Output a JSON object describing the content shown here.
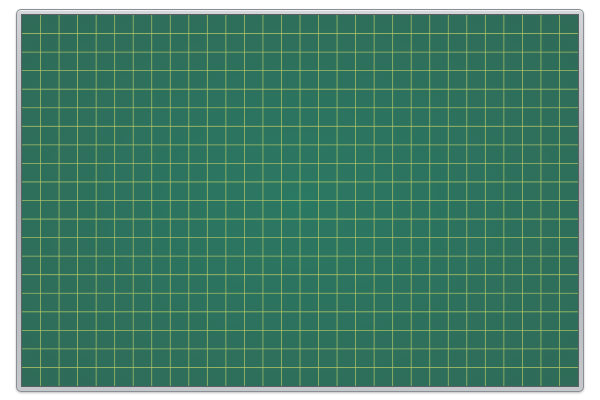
{
  "board": {
    "surface_color": "#2f6b58",
    "surface_color_center": "#2b7863",
    "frame_color": "#b3b6ba",
    "grid_color": "#b6c96a",
    "grid_columns": 30,
    "grid_rows": 20
  }
}
